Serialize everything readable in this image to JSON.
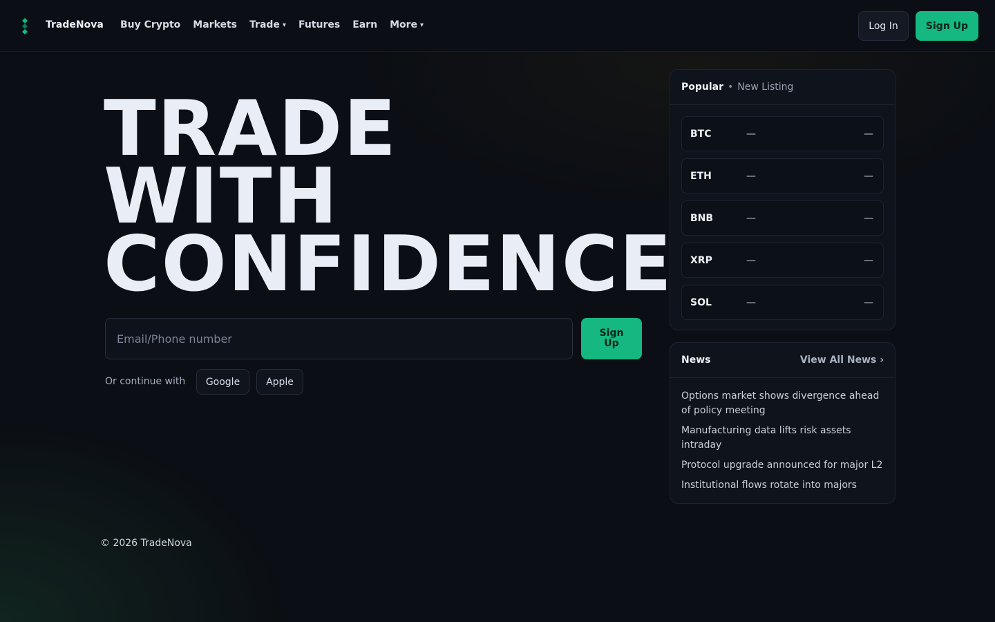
{
  "header": {
    "brand": "TradeNova",
    "nav": [
      {
        "label": "Buy Crypto",
        "caret": ""
      },
      {
        "label": "Markets",
        "caret": ""
      },
      {
        "label": "Trade",
        "caret": "▾"
      },
      {
        "label": "Futures",
        "caret": ""
      },
      {
        "label": "Earn",
        "caret": ""
      },
      {
        "label": "More",
        "caret": "▾"
      }
    ],
    "login_label": "Log In",
    "signup_label": "Sign Up"
  },
  "hero": {
    "title_lines": [
      "TRADE",
      "WITH",
      "CONFIDENCE"
    ],
    "email_placeholder": "Email/Phone number",
    "email_value": "",
    "signup_label": "Sign Up",
    "continue_label": "Or continue with",
    "oauth": [
      "Google",
      "Apple"
    ]
  },
  "markets": {
    "tab_active": "Popular",
    "separator": "•",
    "tab_other": "New Listing",
    "coins": [
      {
        "symbol": "BTC",
        "price": "—",
        "change": "—"
      },
      {
        "symbol": "ETH",
        "price": "—",
        "change": "—"
      },
      {
        "symbol": "BNB",
        "price": "—",
        "change": "—"
      },
      {
        "symbol": "XRP",
        "price": "—",
        "change": "—"
      },
      {
        "symbol": "SOL",
        "price": "—",
        "change": "—"
      }
    ]
  },
  "news": {
    "title": "News",
    "view_all": "View All News ›",
    "items": [
      "Options market shows divergence ahead of policy meeting",
      "Manufacturing data lifts risk assets intraday",
      "Protocol upgrade announced for major L2",
      "Institutional flows rotate into majors"
    ]
  },
  "footer": {
    "copyright": "© 2026 TradeNova"
  },
  "colors": {
    "accent": "#14b880",
    "background": "#0b0e14",
    "card": "#0f131b"
  },
  "icons": {
    "logo": "diamond-stack-icon"
  }
}
